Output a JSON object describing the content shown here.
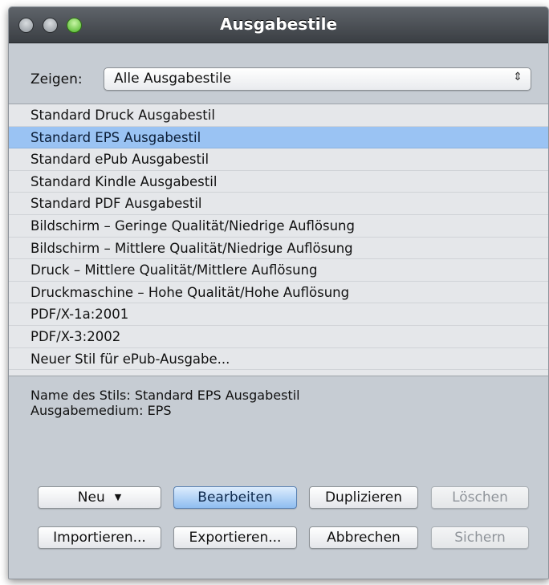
{
  "window": {
    "title": "Ausgabestile"
  },
  "filter": {
    "label": "Zeigen:",
    "selected": "Alle Ausgabestile",
    "arrows_glyph": "⇕"
  },
  "styles": [
    {
      "label": "Standard Druck Ausgabestil",
      "selected": false
    },
    {
      "label": "Standard EPS Ausgabestil",
      "selected": true
    },
    {
      "label": "Standard ePub Ausgabestil",
      "selected": false
    },
    {
      "label": "Standard Kindle Ausgabestil",
      "selected": false
    },
    {
      "label": "Standard PDF Ausgabestil",
      "selected": false
    },
    {
      "label": "Bildschirm – Geringe Qualität/Niedrige Auflösung",
      "selected": false
    },
    {
      "label": "Bildschirm – Mittlere Qualität/Niedrige Auflösung",
      "selected": false
    },
    {
      "label": "Druck – Mittlere Qualität/Mittlere Auflösung",
      "selected": false
    },
    {
      "label": "Druckmaschine – Hohe Qualität/Hohe Auflösung",
      "selected": false
    },
    {
      "label": "PDF/X-1a:2001",
      "selected": false
    },
    {
      "label": "PDF/X-3:2002",
      "selected": false
    },
    {
      "label": "Neuer Stil für ePub-Ausgabe...",
      "selected": false
    }
  ],
  "details": {
    "name_line": "Name des Stils: Standard EPS Ausgabestil",
    "medium_line": "Ausgabemedium: EPS"
  },
  "buttons": {
    "new": "Neu",
    "new_arrow": "▼",
    "edit": "Bearbeiten",
    "duplicate": "Duplizieren",
    "delete": "Löschen",
    "import": "Importieren...",
    "export": "Exportieren...",
    "cancel": "Abbrechen",
    "save": "Sichern"
  },
  "colors": {
    "selection": "#9ac3f3",
    "window_bg": "#c6ccd3",
    "titlebar": "#3a3e43"
  }
}
